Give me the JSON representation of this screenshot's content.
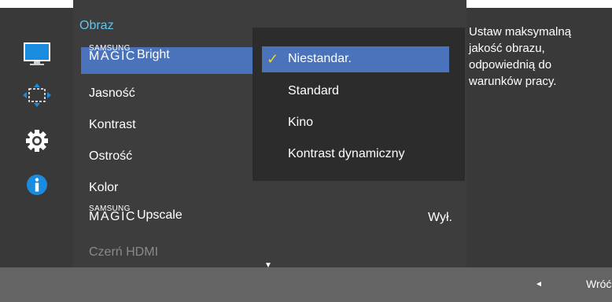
{
  "menu": {
    "title": "Obraz",
    "items": [
      {
        "prefix_top": "SAMSUNG",
        "prefix_bottom": "MAGIC",
        "label": "Bright"
      },
      {
        "label": "Jasność"
      },
      {
        "label": "Kontrast"
      },
      {
        "label": "Ostrość"
      },
      {
        "label": "Kolor"
      },
      {
        "prefix_top": "SAMSUNG",
        "prefix_bottom": "MAGIC",
        "label": "Upscale",
        "value": "Wył."
      },
      {
        "label": "Czerń HDMI"
      }
    ],
    "scroll_indicator": "▼"
  },
  "dropdown": {
    "options": [
      "Niestandar.",
      "Standard",
      "Kino",
      "Kontrast dynamiczny"
    ],
    "selected_index": 0,
    "check_glyph": "✓"
  },
  "help": {
    "text": "Ustaw maksymalną jakość obrazu, odpowiednią do warunków pracy."
  },
  "footer": {
    "back_arrow": "◄",
    "back_label": "Wróć"
  },
  "sidebar": {
    "icons": [
      "monitor-icon",
      "move-arrows-icon",
      "settings-gear-icon",
      "info-icon"
    ]
  },
  "colors": {
    "accent_blue": "#4a73bc",
    "title_cyan": "#5fc5ef",
    "check_yellow": "#e8d72a",
    "panel": "#3d3d3d",
    "footer": "#646464"
  }
}
